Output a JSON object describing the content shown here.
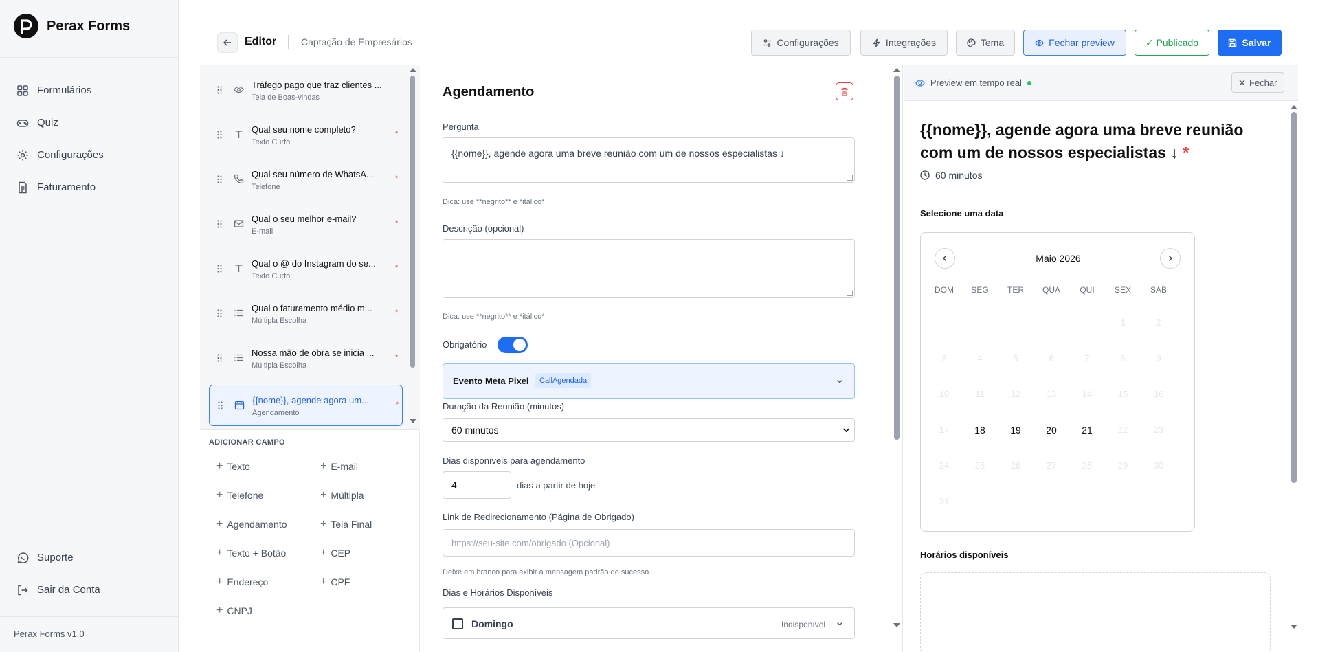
{
  "brand": {
    "name": "Perax Forms",
    "version": "Perax Forms v1.0"
  },
  "sidebar": {
    "items": [
      {
        "label": "Formulários",
        "icon": "grid-icon"
      },
      {
        "label": "Quiz",
        "icon": "gamepad-icon"
      },
      {
        "label": "Configurações",
        "icon": "gear-icon"
      },
      {
        "label": "Faturamento",
        "icon": "document-icon"
      }
    ],
    "bottom": [
      {
        "label": "Suporte",
        "icon": "whatsapp-icon"
      },
      {
        "label": "Sair da Conta",
        "icon": "logout-icon"
      }
    ]
  },
  "header": {
    "editor": "Editor",
    "form_name": "Captação de Empresários",
    "buttons": {
      "settings": "Configurações",
      "integrations": "Integrações",
      "theme": "Tema",
      "close_preview": "Fechar preview",
      "published": "✓ Publicado",
      "save": "Salvar"
    }
  },
  "fields": [
    {
      "title": "Tráfego pago que traz clientes ...",
      "type": "Tela de Boas-vindas",
      "icon": "eye-icon",
      "required": false
    },
    {
      "title": "Qual seu nome completo?",
      "type": "Texto Curto",
      "icon": "text-icon",
      "required": true
    },
    {
      "title": "Qual seu número de WhatsA...",
      "type": "Telefone",
      "icon": "phone-icon",
      "required": true
    },
    {
      "title": "Qual o seu melhor e-mail?",
      "type": "E-mail",
      "icon": "mail-icon",
      "required": true
    },
    {
      "title": "Qual o @ do Instagram do se...",
      "type": "Texto Curto",
      "icon": "text-icon",
      "required": true
    },
    {
      "title": "Qual o faturamento médio m...",
      "type": "Múltipla Escolha",
      "icon": "list-icon",
      "required": true
    },
    {
      "title": "Nossa mão de obra se inicia ...",
      "type": "Múltipla Escolha",
      "icon": "list-icon",
      "required": true
    },
    {
      "title": "{{nome}}, agende agora um...",
      "type": "Agendamento",
      "icon": "calendar-icon",
      "required": true,
      "active": true
    }
  ],
  "required_mark": "*",
  "add_field": {
    "title": "ADICIONAR CAMPO",
    "buttons": [
      "Texto",
      "E-mail",
      "Telefone",
      "Múltipla",
      "Agendamento",
      "Tela Final",
      "Texto + Botão",
      "CEP",
      "Endereço",
      "CPF",
      "CNPJ"
    ]
  },
  "editor": {
    "title": "Agendamento",
    "question_label": "Pergunta",
    "question_value": "{{nome}}, agende agora uma breve reunião com um de nossos especialistas ↓",
    "hint": "Dica: use **negrito** e *itálico*",
    "description_label": "Descrição (opcional)",
    "description_value": "",
    "required_label": "Obrigatório",
    "required_on": true,
    "meta_label": "Evento Meta Pixel",
    "meta_tag": "CallAgendada",
    "duration_label": "Duração da Reunião (minutos)",
    "duration_value": "60 minutos",
    "days_label": "Dias disponíveis para agendamento",
    "days_value": "4",
    "days_suffix": "dias a partir de hoje",
    "redirect_label": "Link de Redirecionamento (Página de Obrigado)",
    "redirect_placeholder": "https://seu-site.com/obrigado (Opcional)",
    "redirect_hint": "Deixe em branco para exibir a mensagem padrão de sucesso.",
    "schedule_label": "Dias e Horários Disponíveis",
    "schedule_day": "Domingo",
    "schedule_status": "Indisponível"
  },
  "preview": {
    "label": "Preview em tempo real",
    "close": "Fechar",
    "question": "{{nome}}, agende agora uma breve reunião com um de nossos especialistas ↓",
    "required_mark": "*",
    "duration": "60 minutos",
    "select_date": "Selecione uma data",
    "month": "Maio 2026",
    "weekdays": [
      "DOM",
      "SEG",
      "TER",
      "QUA",
      "QUI",
      "SEX",
      "SAB"
    ],
    "weeks": [
      [
        "",
        "",
        "",
        "",
        "",
        "1",
        "2"
      ],
      [
        "3",
        "4",
        "5",
        "6",
        "7",
        "8",
        "9"
      ],
      [
        "10",
        "11",
        "12",
        "13",
        "14",
        "15",
        "16"
      ],
      [
        "17",
        "18",
        "19",
        "20",
        "21",
        "22",
        "23"
      ],
      [
        "24",
        "25",
        "26",
        "27",
        "28",
        "29",
        "30"
      ],
      [
        "31",
        "",
        "",
        "",
        "",
        "",
        ""
      ]
    ],
    "available_days": [
      "18",
      "19",
      "20",
      "21"
    ],
    "slots_label": "Horários disponíveis"
  },
  "colors": {
    "primary": "#1d6ef5",
    "success": "#16a34a",
    "danger": "#ef4444"
  }
}
